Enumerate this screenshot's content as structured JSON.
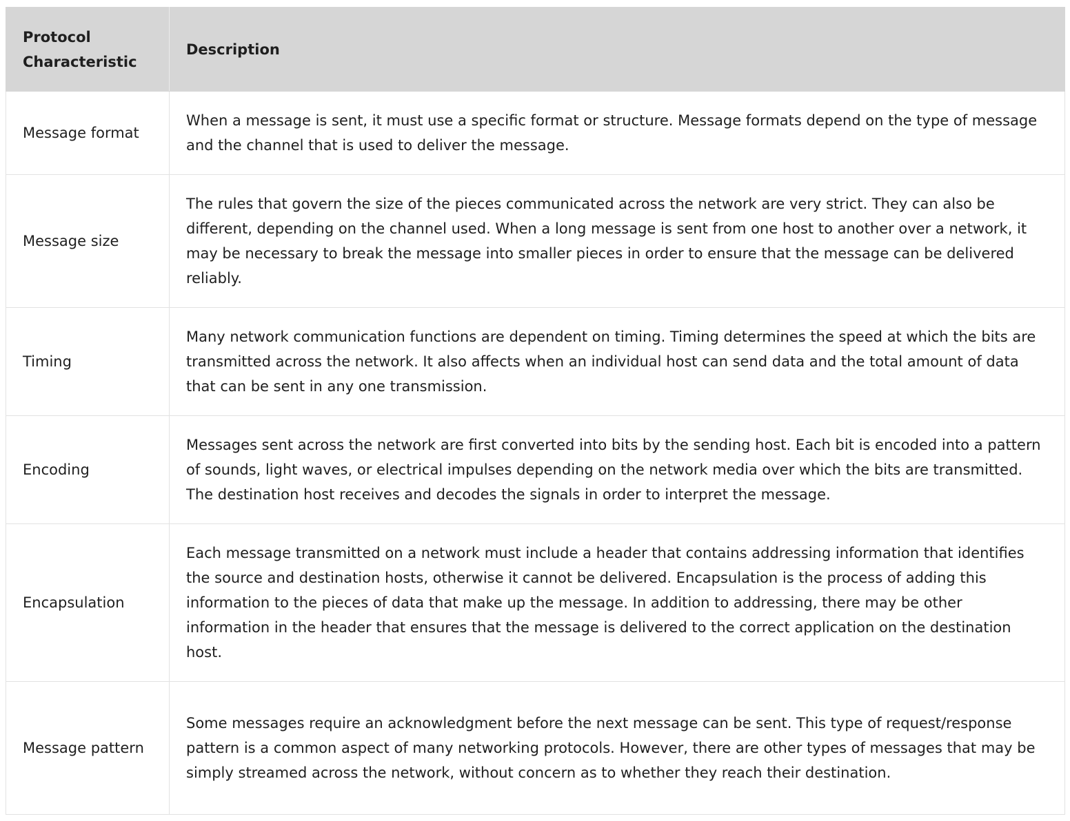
{
  "table": {
    "headers": [
      "Protocol Characteristic",
      "Description"
    ],
    "rows": [
      {
        "characteristic": "Message format",
        "description": "When a message is sent, it must use a specific format or structure. Message formats depend on the type of message and the channel that is used to deliver the message."
      },
      {
        "characteristic": "Message size",
        "description": "The rules that govern the size of the pieces communicated across the network are very strict. They can also be different, depending on the channel used. When a long message is sent from one host to another over a network, it may be necessary to break the message into smaller pieces in order to ensure that the message can be delivered reliably."
      },
      {
        "characteristic": "Timing",
        "description": "Many network communication functions are dependent on timing. Timing determines the speed at which the bits are transmitted across the network. It also affects when an individual host can send data and the total amount of data that can be sent in any one transmission."
      },
      {
        "characteristic": "Encoding",
        "description": "Messages sent across the network are first converted into bits by the sending host. Each bit is encoded into a pattern of sounds, light waves, or electrical impulses depending on the network media over which the bits are transmitted. The destination host receives and decodes the signals in order to interpret the message."
      },
      {
        "characteristic": "Encapsulation",
        "description": "Each message transmitted on a network must include a header that contains addressing information that identifies the source and destination hosts, otherwise it cannot be delivered. Encapsulation is the process of adding this information to the pieces of data that make up the message. In addition to addressing, there may be other information in the header that ensures that the message is delivered to the correct application on the destination host."
      },
      {
        "characteristic": "Message pattern",
        "description": "Some messages require an acknowledgment before the next message can be sent. This type of request/response pattern is a common aspect of many networking protocols. However, there are other types of messages that may be simply streamed across the network, without concern as to whether they reach their destination."
      }
    ]
  }
}
